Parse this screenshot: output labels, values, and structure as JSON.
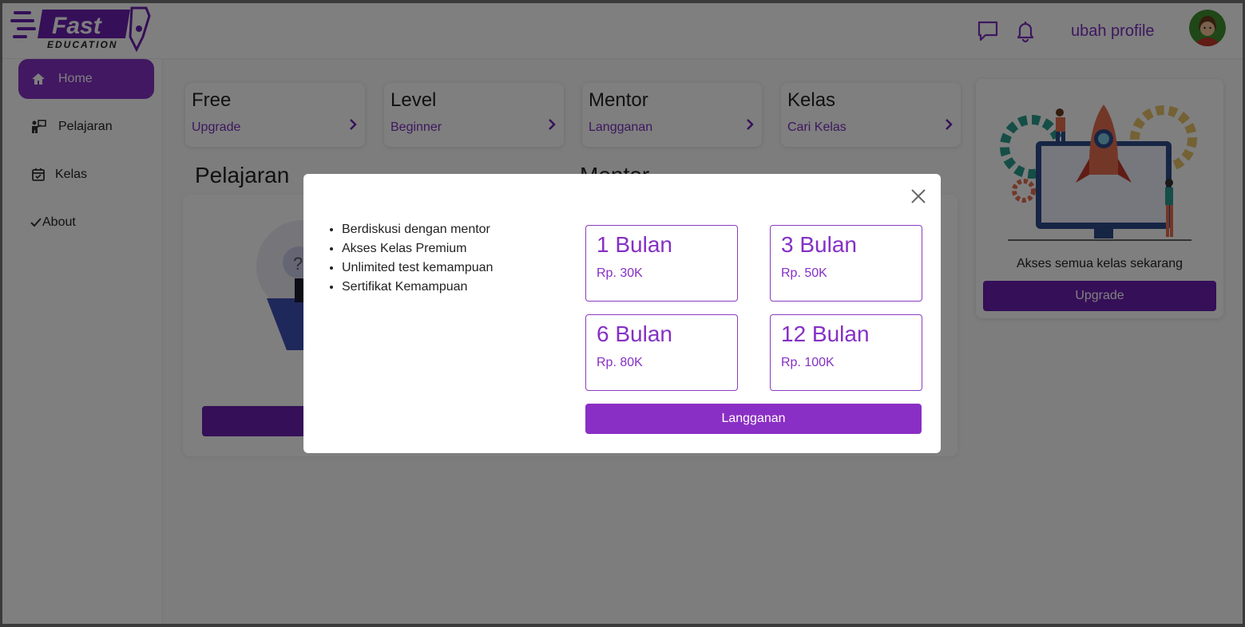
{
  "brand": {
    "name": "Fast",
    "subtitle": "EDUCATION"
  },
  "header": {
    "profile_link": "ubah profile",
    "icons": [
      "chat-icon",
      "bell-icon"
    ]
  },
  "sidebar": {
    "items": [
      {
        "label": "Home",
        "icon": "home-icon",
        "active": true
      },
      {
        "label": "Pelajaran",
        "icon": "teacher-icon",
        "active": false
      },
      {
        "label": "Kelas",
        "icon": "calendar-icon",
        "active": false
      },
      {
        "label": "About",
        "icon": "check-icon",
        "active": false
      }
    ]
  },
  "cards": [
    {
      "title": "Free",
      "subtitle": "Upgrade"
    },
    {
      "title": "Level",
      "subtitle": "Beginner"
    },
    {
      "title": "Mentor",
      "subtitle": "Langganan"
    },
    {
      "title": "Kelas",
      "subtitle": "Cari Kelas"
    }
  ],
  "sections": {
    "pelajaran": "Pelajaran",
    "mentor": "Mentor"
  },
  "upgrade_card": {
    "text": "Akses semua kelas sekarang",
    "button": "Upgrade"
  },
  "modal": {
    "features": [
      "Berdiskusi dengan mentor",
      "Akses Kelas Premium",
      "Unlimited test kemampuan",
      "Sertifikat Kemampuan"
    ],
    "plans": [
      {
        "name": "1 Bulan",
        "price": "Rp. 30K"
      },
      {
        "name": "3 Bulan",
        "price": "Rp. 50K"
      },
      {
        "name": "6 Bulan",
        "price": "Rp. 80K"
      },
      {
        "name": "12 Bulan",
        "price": "Rp. 100K"
      }
    ],
    "subscribe_button": "Langganan"
  },
  "colors": {
    "accent": "#8530c5",
    "overlay": "rgba(0,0,0,0.5)"
  }
}
